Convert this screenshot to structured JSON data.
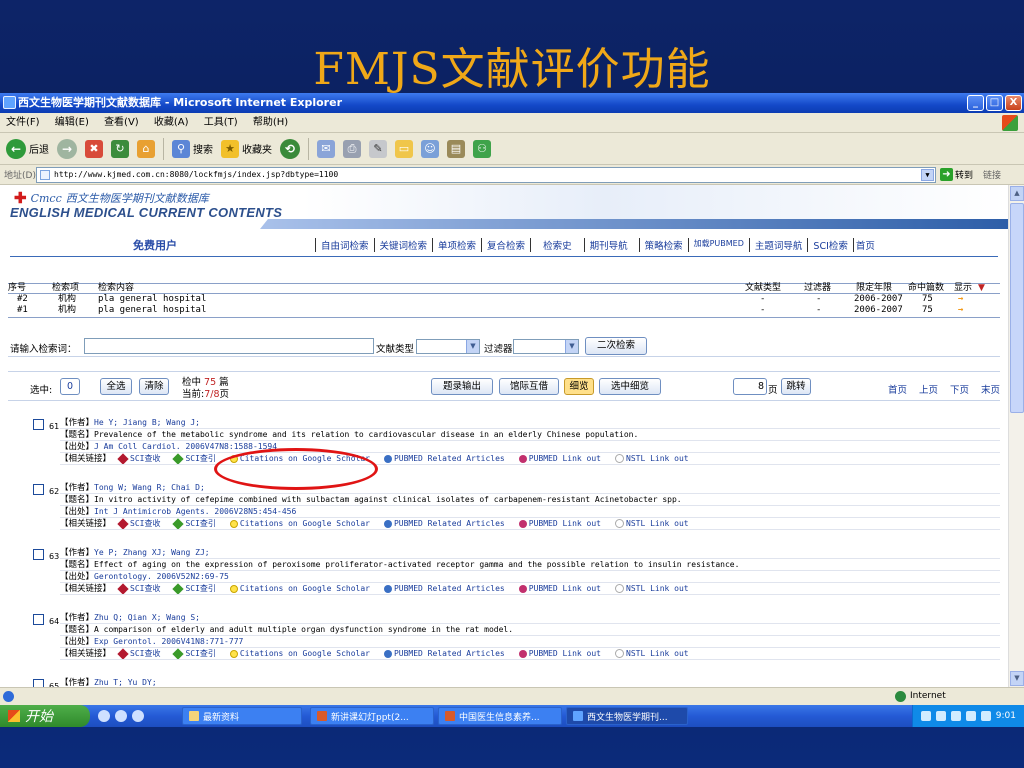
{
  "slide": {
    "title": "FMJS文献评价功能"
  },
  "window": {
    "title": "西文生物医学期刊文献数据库 - Microsoft Internet Explorer",
    "controls": [
      "_",
      "□",
      "X"
    ]
  },
  "menu": [
    "文件(F)",
    "编辑(E)",
    "查看(V)",
    "收藏(A)",
    "工具(T)",
    "帮助(H)"
  ],
  "toolbar": {
    "back": "后退",
    "search": "搜索",
    "favorites": "收藏夹"
  },
  "address": {
    "label": "地址(D)",
    "url": "http://www.kjmed.com.cn:8080/lockfmjs/index.jsp?dbtype=1100",
    "go": "转到",
    "links": "链接"
  },
  "site": {
    "logo_cn": "西文生物医学期刊文献数据库",
    "logo_brand": "Cmcc",
    "logo_en": "ENGLISH MEDICAL CURRENT CONTENTS",
    "user": "免费用户",
    "nav": [
      "自由词检索",
      "关键词检索",
      "单项检索",
      "复合检索",
      "检索史",
      "期刊导航",
      "策略检索",
      "加载PUBMED",
      "主题词导航",
      "SCI检索",
      "首页"
    ]
  },
  "history": {
    "headers": [
      "序号",
      "检索项",
      "检索内容",
      "文献类型",
      "过滤器",
      "限定年限",
      "命中篇数",
      "显示"
    ],
    "rows": [
      {
        "no": "#2",
        "field": "机构",
        "content": "pla general hospital",
        "type": "-",
        "filter": "-",
        "years": "2006-2007",
        "hits": "75",
        "show": "→"
      },
      {
        "no": "#1",
        "field": "机构",
        "content": "pla general hospital",
        "type": "-",
        "filter": "-",
        "years": "2006-2007",
        "hits": "75",
        "show": "→"
      }
    ]
  },
  "search": {
    "label": "请输入检索词：",
    "value": "",
    "doctype_label": "文献类型",
    "filter_label": "过滤器",
    "button": "二次检索"
  },
  "controls": {
    "selected_label": "选中:",
    "selected_count": "0",
    "select_all": "全选",
    "clear": "清除",
    "hits_label": "检中",
    "hits": "75",
    "hits_unit": "篇",
    "current_label": "当前:",
    "current": "7/8",
    "current_unit": "页",
    "export": "题录输出",
    "ill": "馆际互借",
    "detail": "细览",
    "selected_detail": "选中细览",
    "page_input": "8",
    "page_unit": "页",
    "jump": "跳转",
    "first": "首页",
    "prev": "上页",
    "next": "下页",
    "last": "末页"
  },
  "link_labels": {
    "sci_cited": "SCI查收",
    "sci_ref": "SCI查引",
    "scholar": "Citations on Google Scholar",
    "pubmed": "PUBMED Related Articles",
    "pubmed_out": "PUBMED Link out",
    "nstl": "NSTL Link out"
  },
  "field_labels": {
    "author": "【作者】",
    "title": "【题名】",
    "source": "【出处】",
    "links": "【相关链接】"
  },
  "records": [
    {
      "no": "61",
      "authors": "He Y; Jiang B; Wang J;",
      "title": "Prevalence of the metabolic syndrome and its relation to cardiovascular disease in an elderly Chinese population.",
      "source": "J Am Coll Cardiol. 2006V47N8:1588-1594"
    },
    {
      "no": "62",
      "authors": "Tong W; Wang R; Chai D;",
      "title": "In vitro activity of cefepime combined with sulbactam against clinical isolates of carbapenem-resistant Acinetobacter spp.",
      "source": "Int J Antimicrob Agents. 2006V28N5:454-456"
    },
    {
      "no": "63",
      "authors": "Ye P; Zhang XJ; Wang ZJ;",
      "title": "Effect of aging on the expression of peroxisome proliferator-activated receptor gamma and the possible relation to insulin resistance.",
      "source": "Gerontology. 2006V52N2:69-75"
    },
    {
      "no": "64",
      "authors": "Zhu Q; Qian X; Wang S;",
      "title": "A comparison of elderly and adult multiple organ dysfunction syndrome in the rat model.",
      "source": "Exp Gerontol. 2006V41N8:771-777"
    },
    {
      "no": "65",
      "authors": "Zhu T; Yu DY;",
      "title": "",
      "source": ""
    }
  ],
  "status": {
    "zone": "Internet"
  },
  "taskbar": {
    "start": "开始",
    "tasks": [
      "最新资料",
      "新讲课幻灯ppt(2...",
      "中国医生信息素养...",
      "西文生物医学期刊..."
    ],
    "clock": "9:01"
  },
  "colors": {
    "accent_title": "#f0a818",
    "link_blue": "#1a3d9c",
    "annotation_red": "#e01414"
  }
}
